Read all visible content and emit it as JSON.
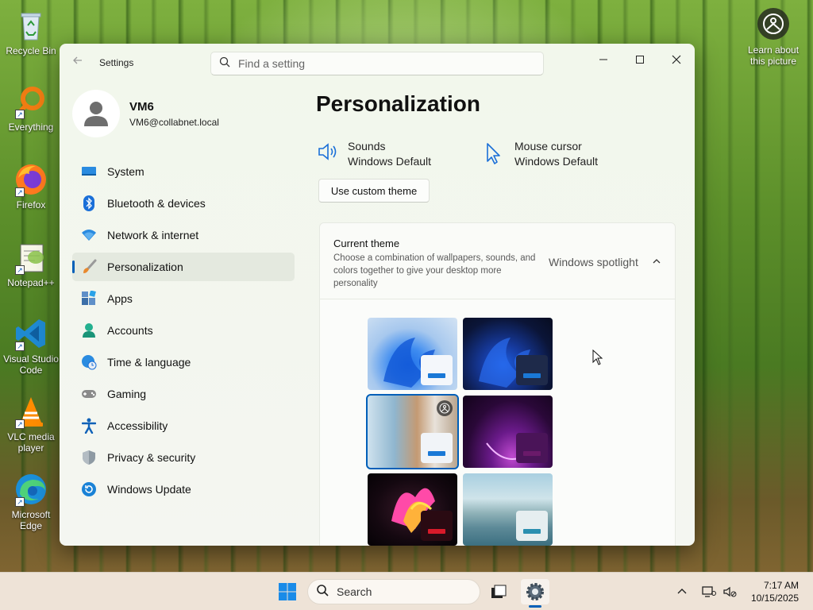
{
  "desktop": {
    "icons": [
      {
        "label": "Recycle Bin"
      },
      {
        "label": "Everything"
      },
      {
        "label": "Firefox"
      },
      {
        "label": "Notepad++"
      },
      {
        "label": "Visual Studio Code"
      },
      {
        "label": "VLC media player"
      },
      {
        "label": "Microsoft Edge"
      }
    ],
    "learn_label": "Learn about this picture"
  },
  "window": {
    "app_title": "Settings",
    "search_placeholder": "Find a setting",
    "profile": {
      "name": "VM6",
      "email": "VM6@collabnet.local"
    },
    "nav": [
      {
        "label": "System",
        "icon": "monitor-icon",
        "color": "#0067c0"
      },
      {
        "label": "Bluetooth & devices",
        "icon": "bluetooth-icon",
        "color": "#0a64d2"
      },
      {
        "label": "Network & internet",
        "icon": "wifi-icon",
        "color": "#1a7fd6"
      },
      {
        "label": "Personalization",
        "icon": "brush-icon",
        "color": "#e07a2a",
        "active": true
      },
      {
        "label": "Apps",
        "icon": "apps-icon",
        "color": "#3c6fa8"
      },
      {
        "label": "Accounts",
        "icon": "person-icon",
        "color": "#1fa88a"
      },
      {
        "label": "Time & language",
        "icon": "globe-clock-icon",
        "color": "#2a89d6"
      },
      {
        "label": "Gaming",
        "icon": "gamepad-icon",
        "color": "#777"
      },
      {
        "label": "Accessibility",
        "icon": "accessibility-icon",
        "color": "#1061b8"
      },
      {
        "label": "Privacy & security",
        "icon": "shield-icon",
        "color": "#7d8a94"
      },
      {
        "label": "Windows Update",
        "icon": "refresh-icon",
        "color": "#1a82d6"
      }
    ],
    "page_title": "Personalization",
    "sounds": {
      "label": "Sounds",
      "value": "Windows Default"
    },
    "cursor": {
      "label": "Mouse cursor",
      "value": "Windows Default"
    },
    "custom_theme_button": "Use custom theme",
    "current_theme": {
      "title": "Current theme",
      "description": "Choose a combination of wallpapers, sounds, and colors together to give your desktop more personality",
      "value": "Windows spotlight"
    },
    "themes": [
      {
        "name": "windows-light-theme",
        "accent": "#1a78d6",
        "selected": false
      },
      {
        "name": "windows-dark-theme",
        "accent": "#1a78d6",
        "selected": false
      },
      {
        "name": "windows-spotlight-theme",
        "accent": "#1a78d6",
        "selected": true
      },
      {
        "name": "glow-theme",
        "accent": "#6a1a6a",
        "selected": false
      },
      {
        "name": "captured-motion-theme",
        "accent": "#d81a2a",
        "selected": false
      },
      {
        "name": "flow-theme",
        "accent": "#2a8fb0",
        "selected": false
      }
    ]
  },
  "taskbar": {
    "search_label": "Search",
    "time": "7:17 AM",
    "date": "10/15/2025"
  },
  "colors": {
    "accent": "#005fb8"
  }
}
